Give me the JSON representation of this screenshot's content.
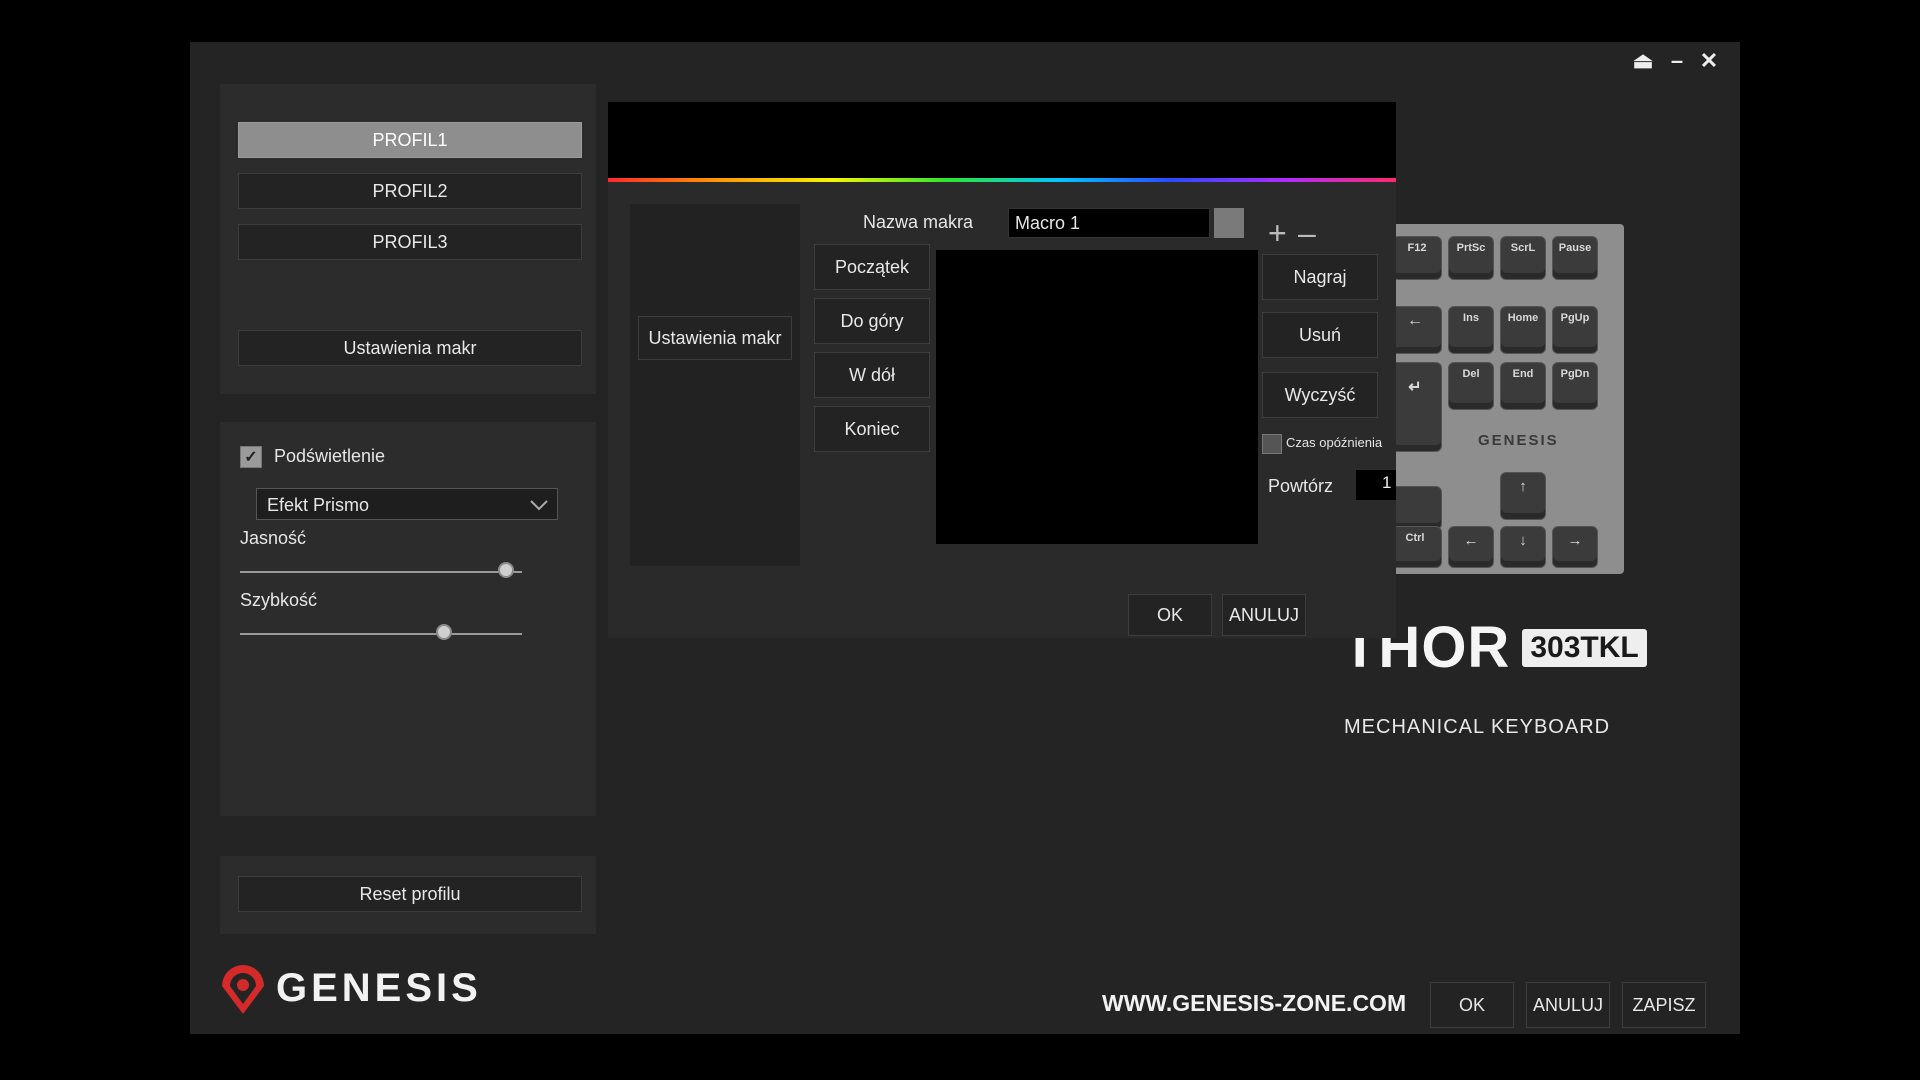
{
  "window_controls": {
    "eject": "⏏",
    "minimize": "–",
    "close": "✕"
  },
  "profiles": [
    {
      "label": "PROFIL1",
      "active": true
    },
    {
      "label": "PROFIL2",
      "active": false
    },
    {
      "label": "PROFIL3",
      "active": false
    }
  ],
  "macro_settings_label": "Ustawienia makr",
  "lighting": {
    "checkbox_label": "Podświetlenie",
    "checked": true,
    "effect": "Efekt Prismo",
    "brightness_label": "Jasność",
    "brightness_value": 0.95,
    "speed_label": "Szybkość",
    "speed_value": 0.73
  },
  "reset_label": "Reset profilu",
  "brand": {
    "name": "GENESIS",
    "url": "WWW.GENESIS-ZONE.COM",
    "product_name": "THOR",
    "product_model": "303TKL",
    "product_sub": "MECHANICAL KEYBOARD",
    "keyboard_logo": "GENESIS"
  },
  "footer": {
    "ok": "OK",
    "cancel": "ANULUJ",
    "save": "ZAPISZ"
  },
  "macro_dialog": {
    "side_label": "Ustawienia makr",
    "name_label": "Nazwa makra",
    "name_value": "Macro 1",
    "add": "+",
    "remove": "–",
    "nav_buttons": [
      "Początek",
      "Do góry",
      "W dół",
      "Koniec"
    ],
    "actions": {
      "record": "Nagraj",
      "delete": "Usuń",
      "clear": "Wyczyść"
    },
    "delay_label": "Czas opóźnienia",
    "delay_checked": false,
    "repeat_label": "Powtórz",
    "repeat_value": "1",
    "ok": "OK",
    "cancel": "ANULUJ"
  },
  "keys": {
    "f12": "F12",
    "prtsc": "PrtSc",
    "scrl": "ScrL",
    "pause": "Pause",
    "backspace": "←",
    "ins": "Ins",
    "home": "Home",
    "pgup": "PgUp",
    "enter": "↵",
    "del": "Del",
    "end": "End",
    "pgdn": "PgDn",
    "ctrl": "Ctrl",
    "up": "↑",
    "left": "←",
    "down": "↓",
    "right": "→"
  },
  "colors": {
    "accent_red": "#d42a2a",
    "panel": "#2c2c2c",
    "window": "#242424"
  }
}
